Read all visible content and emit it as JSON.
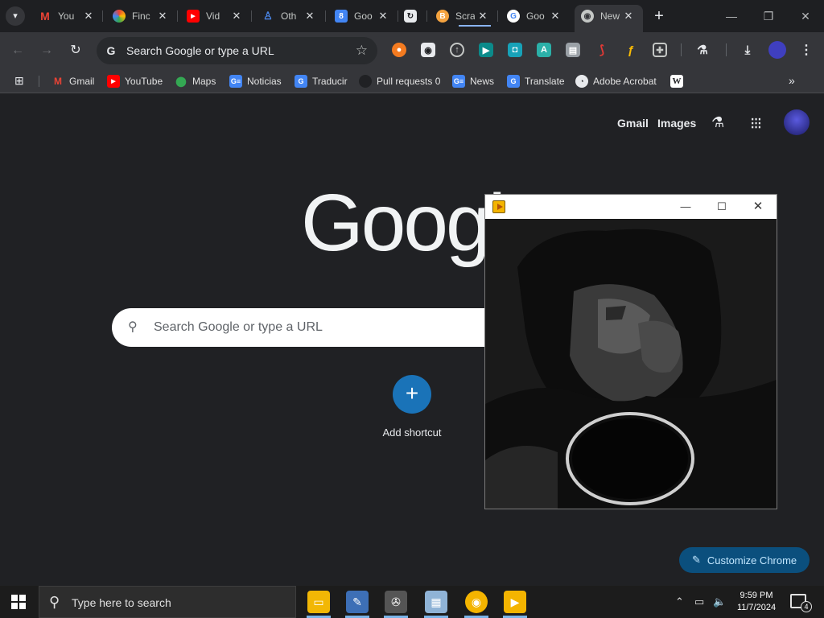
{
  "browser": {
    "tabs": [
      {
        "label": "You",
        "icon": "gmail-icon",
        "color": "#ea4335"
      },
      {
        "label": "Finc",
        "icon": "lens-icon",
        "color": "#8e44ad"
      },
      {
        "label": "Vid",
        "icon": "youtube-icon",
        "color": "#ff0000"
      },
      {
        "label": "Oth",
        "icon": "person-icon",
        "color": "#1a73e8"
      },
      {
        "label": "Goo",
        "icon": "docs-icon",
        "color": "#4285f4"
      },
      {
        "label": "",
        "icon": "loop-icon",
        "color": "#e8eaed"
      },
      {
        "label": "Scra",
        "icon": "blogger-icon",
        "color": "#f4a340"
      },
      {
        "label": "Goo",
        "icon": "google-icon",
        "color": "#ffffff"
      },
      {
        "label": "New",
        "icon": "chrome-icon",
        "color": "#c4c7c5"
      }
    ],
    "new_tab_symbol": "+",
    "omnibox_placeholder": "Search Google or type a URL",
    "bookmarks": [
      {
        "label": "Gmail",
        "icon": "gmail-icon"
      },
      {
        "label": "YouTube",
        "icon": "youtube-icon"
      },
      {
        "label": "Maps",
        "icon": "maps-icon"
      },
      {
        "label": "Noticias",
        "icon": "google-news-icon"
      },
      {
        "label": "Traducir",
        "icon": "translate-icon"
      },
      {
        "label": "Pull requests 0",
        "icon": "github-icon"
      },
      {
        "label": "News",
        "icon": "google-news-icon"
      },
      {
        "label": "Translate",
        "icon": "translate-icon"
      },
      {
        "label": "Adobe Acrobat",
        "icon": "acrobat-icon"
      },
      {
        "label": "",
        "icon": "wikipedia-icon"
      }
    ]
  },
  "ntp": {
    "gmail_link": "Gmail",
    "images_link": "Images",
    "logo_text": "Googl",
    "search_placeholder": "Search Google or type a URL",
    "add_shortcut": "Add shortcut",
    "customize": "Customize Chrome"
  },
  "taskbar": {
    "search_placeholder": "Type here to search",
    "time": "9:59 PM",
    "date": "11/7/2024",
    "notification_count": "4"
  }
}
